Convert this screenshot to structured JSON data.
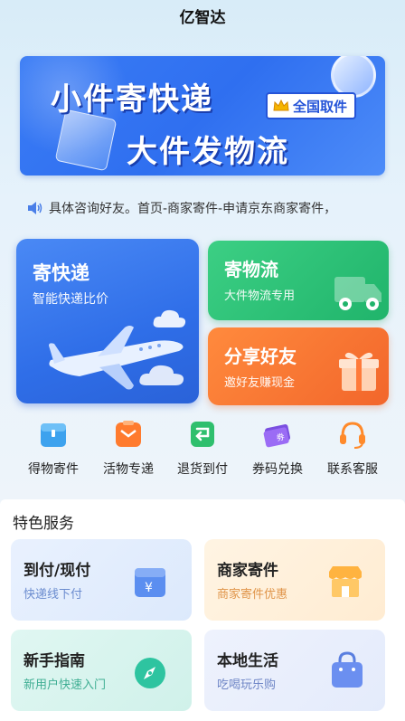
{
  "app": {
    "title": "亿智达"
  },
  "banner": {
    "line1": "小件寄快递",
    "line2": "大件发物流",
    "badge": "全国取件"
  },
  "notice": {
    "text": "具体咨询好友。首页-商家寄件-申请京东商家寄件，"
  },
  "cards": {
    "express": {
      "title": "寄快递",
      "subtitle": "智能快递比价"
    },
    "logistics": {
      "title": "寄物流",
      "subtitle": "大件物流专用"
    },
    "share": {
      "title": "分享好友",
      "subtitle": "邀好友赚现金"
    }
  },
  "quick": [
    {
      "label": "得物寄件",
      "icon": "box-icon"
    },
    {
      "label": "活物专递",
      "icon": "package-icon"
    },
    {
      "label": "退货到付",
      "icon": "return-icon"
    },
    {
      "label": "券码兑换",
      "icon": "coupon-icon"
    },
    {
      "label": "联系客服",
      "icon": "headset-icon"
    }
  ],
  "featured": {
    "title": "特色服务",
    "items": [
      {
        "title": "到付/现付",
        "subtitle": "快递线下付",
        "icon": "yen-box-icon"
      },
      {
        "title": "商家寄件",
        "subtitle": "商家寄件优惠",
        "icon": "store-icon"
      },
      {
        "title": "新手指南",
        "subtitle": "新用户快速入门",
        "icon": "compass-icon"
      },
      {
        "title": "本地生活",
        "subtitle": "吃喝玩乐购",
        "icon": "shopping-bag-icon"
      }
    ]
  },
  "colors": {
    "express_blue": "#2f6ee8",
    "logistics_green": "#20b46b",
    "share_orange": "#f2662b"
  }
}
